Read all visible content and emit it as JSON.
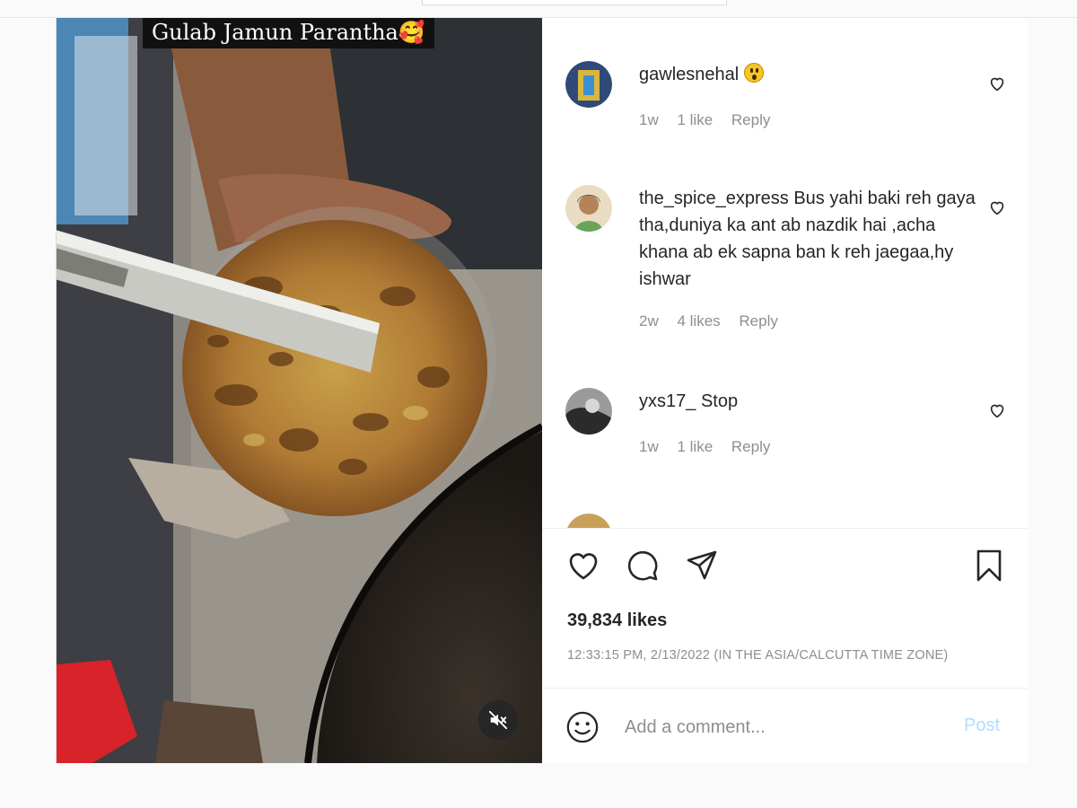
{
  "media": {
    "caption_overlay": "Gulab Jamun Parantha🥰",
    "mute_icon": "speaker-muted-icon"
  },
  "comments": [
    {
      "username": "gawlesnehal",
      "text": "",
      "emoji": "astonished-face-emoji",
      "age": "1w",
      "likes": "1 like",
      "reply": "Reply",
      "avatar_color": "#3a5a8a"
    },
    {
      "username": "the_spice_express",
      "text": "Bus yahi baki reh gaya tha,duniya ka ant ab nazdik hai ,acha khana ab ek sapna ban k reh jaegaa,hy ishwar",
      "age": "2w",
      "likes": "4 likes",
      "reply": "Reply",
      "avatar_color": "#c9a27a"
    },
    {
      "username": "yxs17_",
      "text": "Stop",
      "age": "1w",
      "likes": "1 like",
      "reply": "Reply",
      "avatar_color": "#555555"
    }
  ],
  "actions": {
    "like_icon": "heart-icon",
    "comment_icon": "comment-icon",
    "share_icon": "paper-plane-icon",
    "save_icon": "bookmark-icon"
  },
  "likes_count": "39,834 likes",
  "timestamp": "12:33:15 PM, 2/13/2022 (IN THE ASIA/CALCUTTA TIME ZONE)",
  "add_comment": {
    "placeholder": "Add a comment...",
    "post_label": "Post",
    "emoji_icon": "smiley-icon"
  },
  "colors": {
    "post_button_disabled": "#b3dbff",
    "meta_gray": "#8e8e8e",
    "border": "#dbdbdb"
  }
}
